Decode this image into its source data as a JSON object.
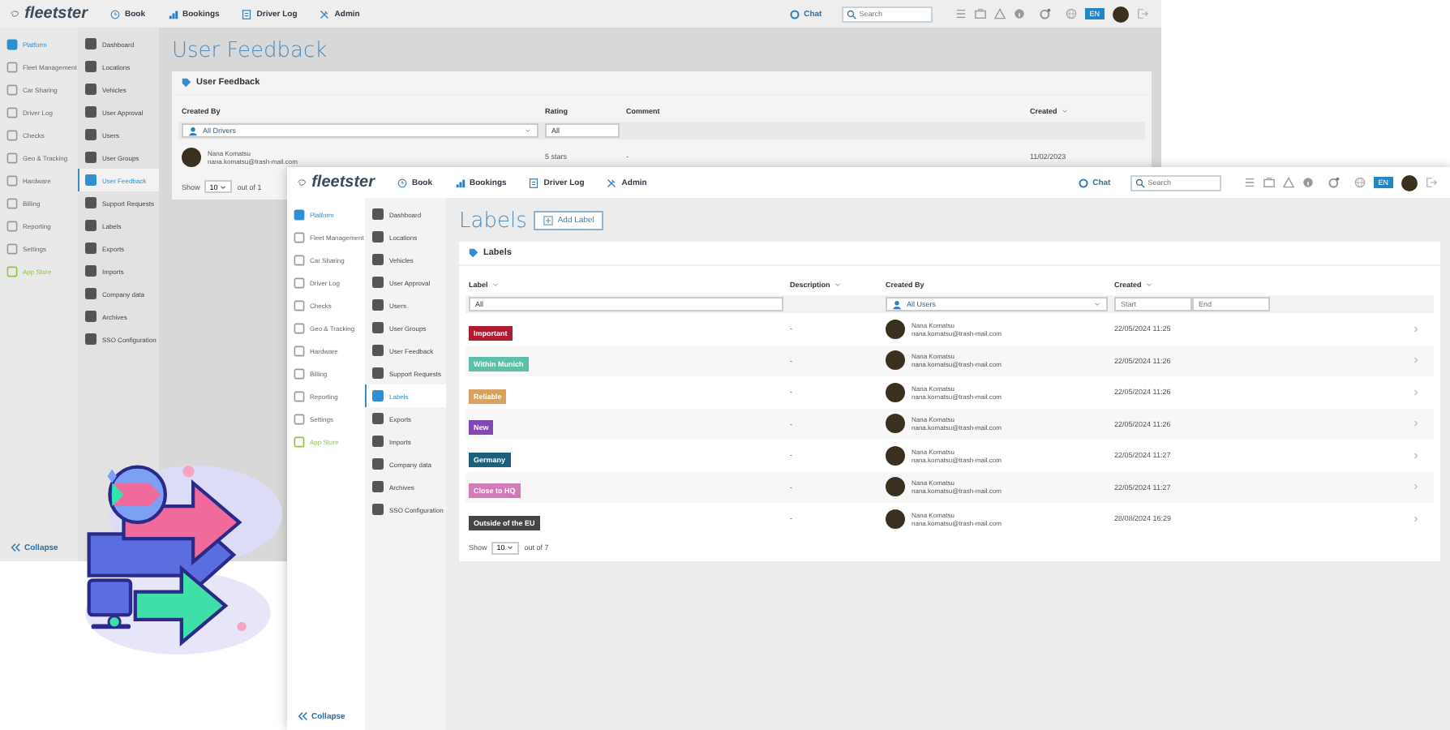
{
  "windows": [
    {
      "kind": "feedback",
      "header": {
        "logo": "fleetster",
        "nav": [
          "Book",
          "Bookings",
          "Driver Log",
          "Admin"
        ],
        "chat": "Chat",
        "search_placeholder": "Search",
        "language": "EN"
      },
      "sidebar": {
        "primary": [
          {
            "label": "Platform",
            "selected": true,
            "kind": "page"
          },
          {
            "label": "Fleet Management",
            "selected": false,
            "kind": "page"
          },
          {
            "label": "Car Sharing",
            "selected": false,
            "kind": "page"
          },
          {
            "label": "Driver Log",
            "selected": false,
            "kind": "page"
          },
          {
            "label": "Checks",
            "selected": false,
            "kind": "page"
          },
          {
            "label": "Geo & Tracking",
            "selected": false,
            "kind": "page"
          },
          {
            "label": "Hardware",
            "selected": false,
            "kind": "page"
          },
          {
            "label": "Billing",
            "selected": false,
            "kind": "page"
          },
          {
            "label": "Reporting",
            "selected": false,
            "kind": "page"
          },
          {
            "label": "Settings",
            "selected": false,
            "kind": "page"
          },
          {
            "label": "App Store",
            "selected": false,
            "kind": "store"
          }
        ],
        "secondary": [
          {
            "label": "Dashboard",
            "selected": false
          },
          {
            "label": "Locations",
            "selected": false
          },
          {
            "label": "Vehicles",
            "selected": false
          },
          {
            "label": "User Approval",
            "selected": false
          },
          {
            "label": "Users",
            "selected": false
          },
          {
            "label": "User Groups",
            "selected": false
          },
          {
            "label": "User Feedback",
            "selected": true
          },
          {
            "label": "Support Requests",
            "selected": false
          },
          {
            "label": "Labels",
            "selected": false
          },
          {
            "label": "Exports",
            "selected": false
          },
          {
            "label": "Imports",
            "selected": false
          },
          {
            "label": "Company data",
            "selected": false
          },
          {
            "label": "Archives",
            "selected": false
          },
          {
            "label": "SSO Configuration",
            "selected": false
          }
        ],
        "collapse": "Collapse"
      },
      "title": "User Feedback",
      "panel": {
        "title": "User Feedback",
        "columns": [
          {
            "label": "Created By",
            "sortable": false
          },
          {
            "label": "Rating",
            "sortable": false
          },
          {
            "label": "Comment",
            "sortable": false
          },
          {
            "label": "Created",
            "sortable": true
          }
        ],
        "filters": {
          "created_by": "All Drivers",
          "rating": "All"
        },
        "rows": [
          {
            "name": "Nana Komatsu",
            "email": "nana.komatsu@trash-mail.com",
            "rating": "5 stars",
            "comment": "-",
            "created": "11/02/2023"
          }
        ],
        "footer": {
          "show": "Show",
          "page_size": "10",
          "count": "out of 1"
        }
      }
    },
    {
      "kind": "labels",
      "header": {
        "logo": "fleetster",
        "nav": [
          "Book",
          "Bookings",
          "Driver Log",
          "Admin"
        ],
        "chat": "Chat",
        "search_placeholder": "Search",
        "language": "EN"
      },
      "sidebar": {
        "primary": [
          {
            "label": "Platform",
            "selected": true,
            "kind": "page"
          },
          {
            "label": "Fleet Management",
            "selected": false,
            "kind": "page"
          },
          {
            "label": "Car Sharing",
            "selected": false,
            "kind": "page"
          },
          {
            "label": "Driver Log",
            "selected": false,
            "kind": "page"
          },
          {
            "label": "Checks",
            "selected": false,
            "kind": "page"
          },
          {
            "label": "Geo & Tracking",
            "selected": false,
            "kind": "page"
          },
          {
            "label": "Hardware",
            "selected": false,
            "kind": "page"
          },
          {
            "label": "Billing",
            "selected": false,
            "kind": "page"
          },
          {
            "label": "Reporting",
            "selected": false,
            "kind": "page"
          },
          {
            "label": "Settings",
            "selected": false,
            "kind": "page"
          },
          {
            "label": "App Store",
            "selected": false,
            "kind": "store"
          }
        ],
        "secondary": [
          {
            "label": "Dashboard",
            "selected": false
          },
          {
            "label": "Locations",
            "selected": false
          },
          {
            "label": "Vehicles",
            "selected": false
          },
          {
            "label": "User Approval",
            "selected": false
          },
          {
            "label": "Users",
            "selected": false
          },
          {
            "label": "User Groups",
            "selected": false
          },
          {
            "label": "User Feedback",
            "selected": false
          },
          {
            "label": "Support Requests",
            "selected": false
          },
          {
            "label": "Labels",
            "selected": true
          },
          {
            "label": "Exports",
            "selected": false
          },
          {
            "label": "Imports",
            "selected": false
          },
          {
            "label": "Company data",
            "selected": false
          },
          {
            "label": "Archives",
            "selected": false
          },
          {
            "label": "SSO Configuration",
            "selected": false
          }
        ],
        "collapse": "Collapse"
      },
      "title": "Labels",
      "add_button": "Add Label",
      "panel": {
        "title": "Labels",
        "columns": [
          {
            "label": "Label",
            "sortable": true
          },
          {
            "label": "Description",
            "sortable": true
          },
          {
            "label": "Created By",
            "sortable": false
          },
          {
            "label": "Created",
            "sortable": true
          }
        ],
        "filters": {
          "label": "All",
          "created_by": "All Users",
          "start_placeholder": "Start",
          "end_placeholder": "End"
        },
        "rows": [
          {
            "label": "Important",
            "color": "#b01c2e",
            "description": "-",
            "name": "Nana Komatsu",
            "email": "nana.komatsu@trash-mail.com",
            "created": "22/05/2024 11:25"
          },
          {
            "label": "Within Munich",
            "color": "#5cbfa6",
            "description": "-",
            "name": "Nana Komatsu",
            "email": "nana.komatsu@trash-mail.com",
            "created": "22/05/2024 11:26"
          },
          {
            "label": "Reliable",
            "color": "#d9a15e",
            "description": "-",
            "name": "Nana Komatsu",
            "email": "nana.komatsu@trash-mail.com",
            "created": "22/05/2024 11:26"
          },
          {
            "label": "New",
            "color": "#8048b0",
            "description": "-",
            "name": "Nana Komatsu",
            "email": "nana.komatsu@trash-mail.com",
            "created": "22/05/2024 11:26"
          },
          {
            "label": "Germany",
            "color": "#1d5f7d",
            "description": "-",
            "name": "Nana Komatsu",
            "email": "nana.komatsu@trash-mail.com",
            "created": "22/05/2024 11:27"
          },
          {
            "label": "Close to HQ",
            "color": "#d17bb8",
            "description": "-",
            "name": "Nana Komatsu",
            "email": "nana.komatsu@trash-mail.com",
            "created": "22/05/2024 11:27"
          },
          {
            "label": "Outside of the EU",
            "color": "#454545",
            "description": "-",
            "name": "Nana Komatsu",
            "email": "nana.komatsu@trash-mail.com",
            "created": "28/08/2024 16:29"
          }
        ],
        "footer": {
          "show": "Show",
          "page_size": "10",
          "count": "out of 7"
        }
      }
    }
  ]
}
